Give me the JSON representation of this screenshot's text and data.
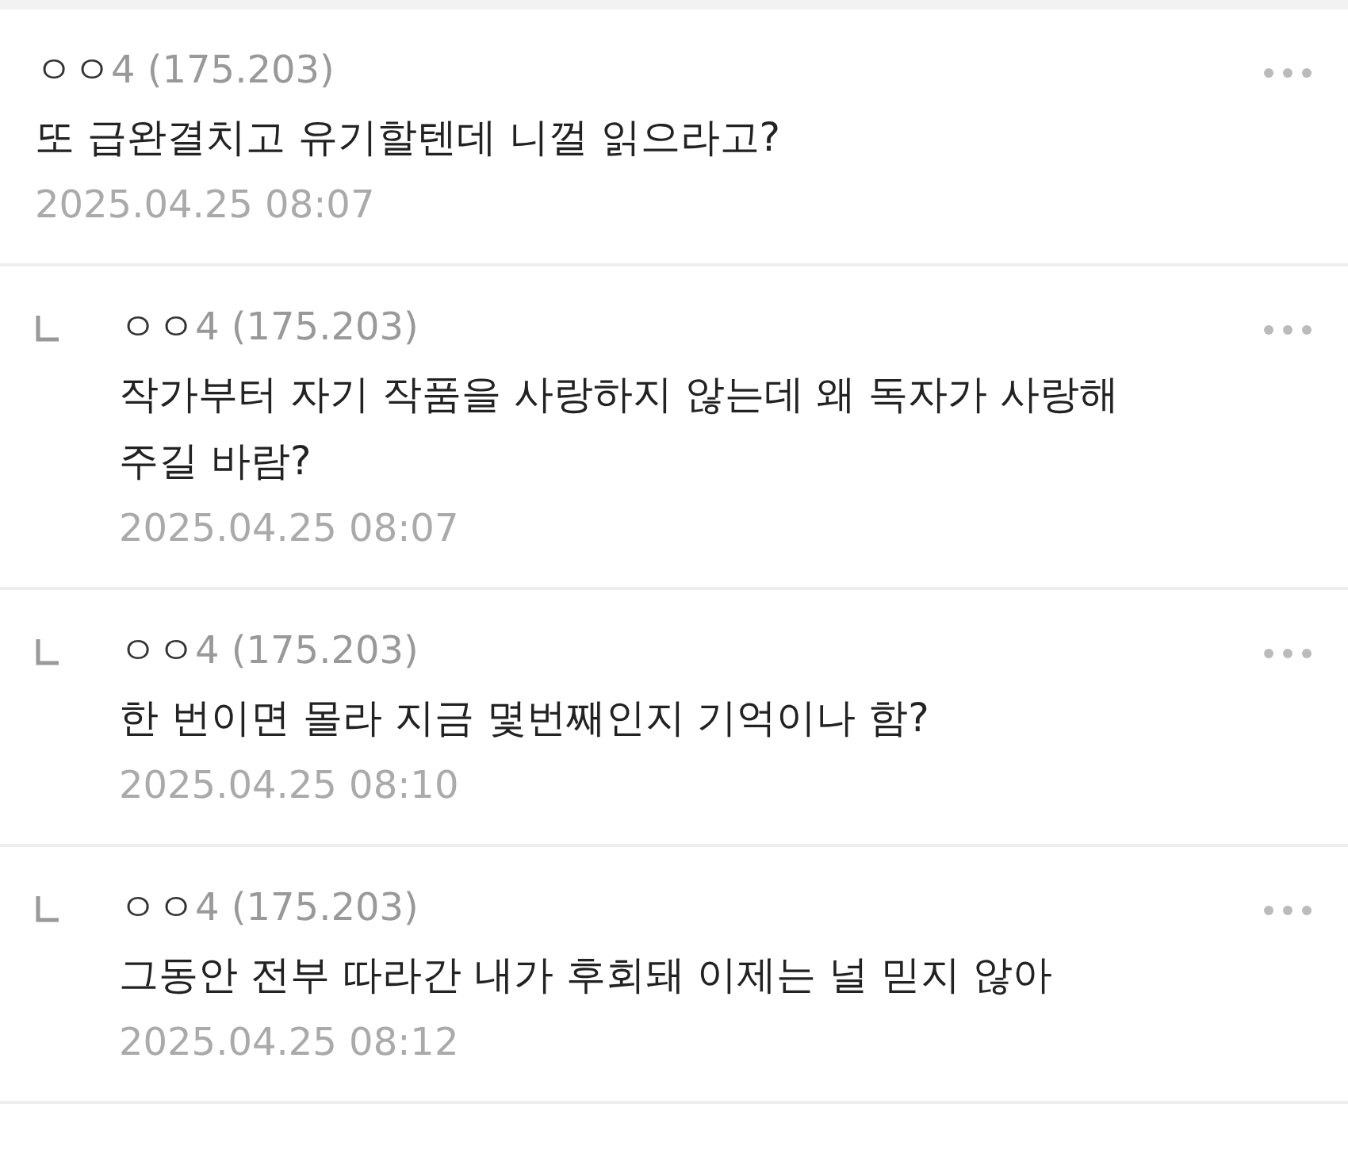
{
  "comments": [
    {
      "kind": "comment",
      "author": "ㅇㅇ",
      "ip": "4 (175.203)",
      "text": "또 급완결치고 유기할텐데 니껄 읽으라고?",
      "time": "2025.04.25 08:07"
    },
    {
      "kind": "reply",
      "author": "ㅇㅇ",
      "ip": "4 (175.203)",
      "text": "작가부터 자기 작품을 사랑하지 않는데 왜 독자가 사랑해주길 바람?",
      "time": "2025.04.25 08:07"
    },
    {
      "kind": "reply",
      "author": "ㅇㅇ",
      "ip": "4 (175.203)",
      "text": "한 번이면 몰라 지금 몇번째인지 기억이나 함?",
      "time": "2025.04.25 08:10"
    },
    {
      "kind": "reply",
      "author": "ㅇㅇ",
      "ip": "4 (175.203)",
      "text": "그동안 전부 따라간 내가 후회돼 이제는 널 믿지 않아",
      "time": "2025.04.25 08:12"
    }
  ]
}
